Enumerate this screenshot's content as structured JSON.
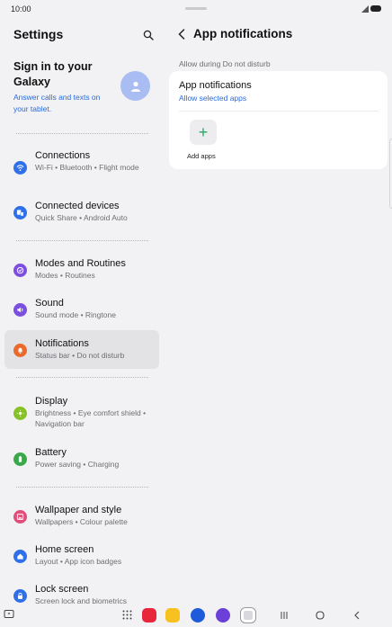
{
  "status_bar": {
    "time": "10:00"
  },
  "left_pane": {
    "title": "Settings",
    "signin": {
      "title": "Sign in to your Galaxy",
      "subtitle": "Answer calls and texts on your tablet."
    },
    "items": [
      {
        "title": "Connections",
        "subtitle": "Wi-Fi  •  Bluetooth  •  Flight mode",
        "color": "#2f6fe8",
        "icon": "wifi-icon"
      },
      {
        "title": "Connected devices",
        "subtitle": "Quick Share  •  Android Auto",
        "color": "#2f6fe8",
        "icon": "devices-icon"
      },
      {
        "title": "Modes and Routines",
        "subtitle": "Modes  •  Routines",
        "color": "#7d4fe0",
        "icon": "check-circle-icon"
      },
      {
        "title": "Sound",
        "subtitle": "Sound mode  •  Ringtone",
        "color": "#7d4fe0",
        "icon": "volume-icon"
      },
      {
        "title": "Notifications",
        "subtitle": "Status bar  •  Do not disturb",
        "color": "#ea6a2c",
        "icon": "bell-icon"
      },
      {
        "title": "Display",
        "subtitle": "Brightness  •  Eye comfort shield  •  Navigation bar",
        "color": "#86c227",
        "icon": "sun-icon"
      },
      {
        "title": "Battery",
        "subtitle": "Power saving  •  Charging",
        "color": "#3aa84a",
        "icon": "battery-icon"
      },
      {
        "title": "Wallpaper and style",
        "subtitle": "Wallpapers  •  Colour palette",
        "color": "#e04f7a",
        "icon": "wallpaper-icon"
      },
      {
        "title": "Home screen",
        "subtitle": "Layout  •  App icon badges",
        "color": "#2f6fe8",
        "icon": "home-icon"
      },
      {
        "title": "Lock screen",
        "subtitle": "Screen lock and biometrics",
        "color": "#2f6fe8",
        "icon": "lock-icon"
      }
    ]
  },
  "right_pane": {
    "title": "App notifications",
    "section_label": "Allow during Do not disturb",
    "card": {
      "title": "App notifications",
      "subtitle": "Allow selected apps",
      "add_label": "Add apps"
    }
  },
  "colors": {
    "accent_link": "#2a6ad8",
    "add_plus": "#28a764",
    "active_item_bg": "#e3e3e6"
  }
}
